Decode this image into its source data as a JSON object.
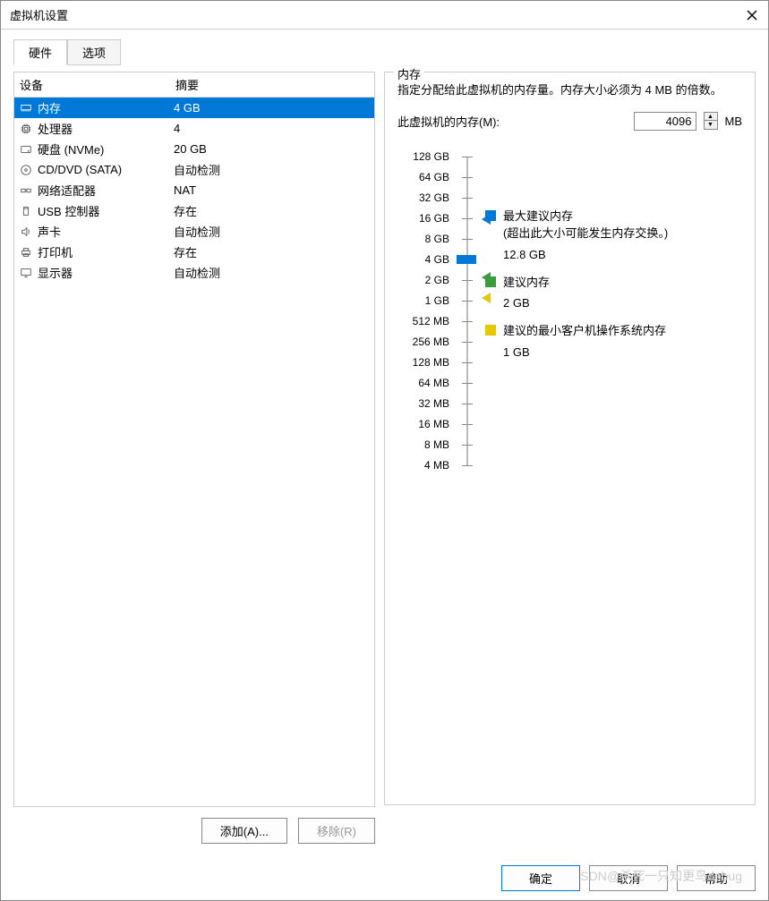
{
  "window": {
    "title": "虚拟机设置"
  },
  "tabs": {
    "hardware": "硬件",
    "options": "选项"
  },
  "headers": {
    "device": "设备",
    "summary": "摘要"
  },
  "devices": [
    {
      "icon": "memory",
      "name": "内存",
      "summary": "4 GB",
      "selected": true
    },
    {
      "icon": "cpu",
      "name": "处理器",
      "summary": "4",
      "selected": false
    },
    {
      "icon": "disk",
      "name": "硬盘 (NVMe)",
      "summary": "20 GB",
      "selected": false
    },
    {
      "icon": "cd",
      "name": "CD/DVD (SATA)",
      "summary": "自动检测",
      "selected": false
    },
    {
      "icon": "network",
      "name": "网络适配器",
      "summary": "NAT",
      "selected": false
    },
    {
      "icon": "usb",
      "name": "USB 控制器",
      "summary": "存在",
      "selected": false
    },
    {
      "icon": "sound",
      "name": "声卡",
      "summary": "自动检测",
      "selected": false
    },
    {
      "icon": "printer",
      "name": "打印机",
      "summary": "存在",
      "selected": false
    },
    {
      "icon": "display",
      "name": "显示器",
      "summary": "自动检测",
      "selected": false
    }
  ],
  "buttons": {
    "add": "添加(A)...",
    "remove": "移除(R)",
    "ok": "确定",
    "cancel": "取消",
    "help": "帮助"
  },
  "memory": {
    "group_title": "内存",
    "desc": "指定分配给此虚拟机的内存量。内存大小必须为 4 MB 的倍数。",
    "input_label": "此虚拟机的内存(M):",
    "input_value": "4096",
    "unit": "MB",
    "scale": [
      "128 GB",
      "64 GB",
      "32 GB",
      "16 GB",
      "8 GB",
      "4 GB",
      "2 GB",
      "1 GB",
      "512 MB",
      "256 MB",
      "128 MB",
      "64 MB",
      "32 MB",
      "16 MB",
      "8 MB",
      "4 MB"
    ],
    "legend": {
      "max_label": "最大建议内存",
      "max_note": "(超出此大小可能发生内存交换。)",
      "max_value": "12.8 GB",
      "rec_label": "建议内存",
      "rec_value": "2 GB",
      "min_label": "建议的最小客户机操作系统内存",
      "min_value": "1 GB"
    }
  },
  "watermark": "SDN@杀死一只知更鸟debug"
}
